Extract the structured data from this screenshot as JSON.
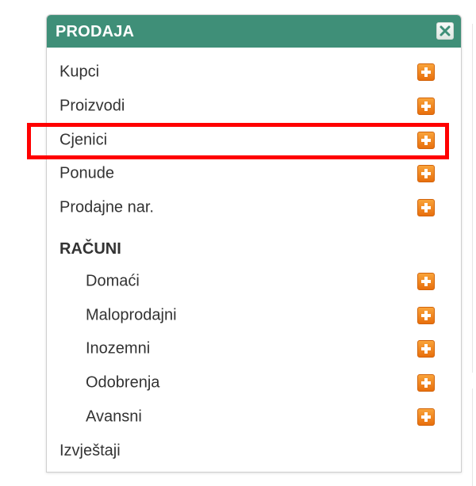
{
  "panel": {
    "title": "PRODAJA",
    "close_icon": "close-icon",
    "header_color": "#3f8f78"
  },
  "menu": {
    "items": [
      {
        "label": "Kupci",
        "icon": "plus-icon"
      },
      {
        "label": "Proizvodi",
        "icon": "plus-icon"
      },
      {
        "label": "Cjenici",
        "icon": "plus-icon",
        "highlighted": true
      },
      {
        "label": "Ponude",
        "icon": "plus-icon"
      },
      {
        "label": "Prodajne nar.",
        "icon": "plus-icon"
      }
    ],
    "section": {
      "heading": "RAČUNI",
      "items": [
        {
          "label": "Domaći",
          "icon": "plus-icon"
        },
        {
          "label": "Maloprodajni",
          "icon": "plus-icon"
        },
        {
          "label": "Inozemni",
          "icon": "plus-icon"
        },
        {
          "label": "Odobrenja",
          "icon": "plus-icon"
        },
        {
          "label": "Avansni",
          "icon": "plus-icon"
        }
      ]
    },
    "footer_item": {
      "label": "Izvještaji"
    }
  },
  "highlight_color": "#ff0000",
  "plus_color": "#f08a24"
}
